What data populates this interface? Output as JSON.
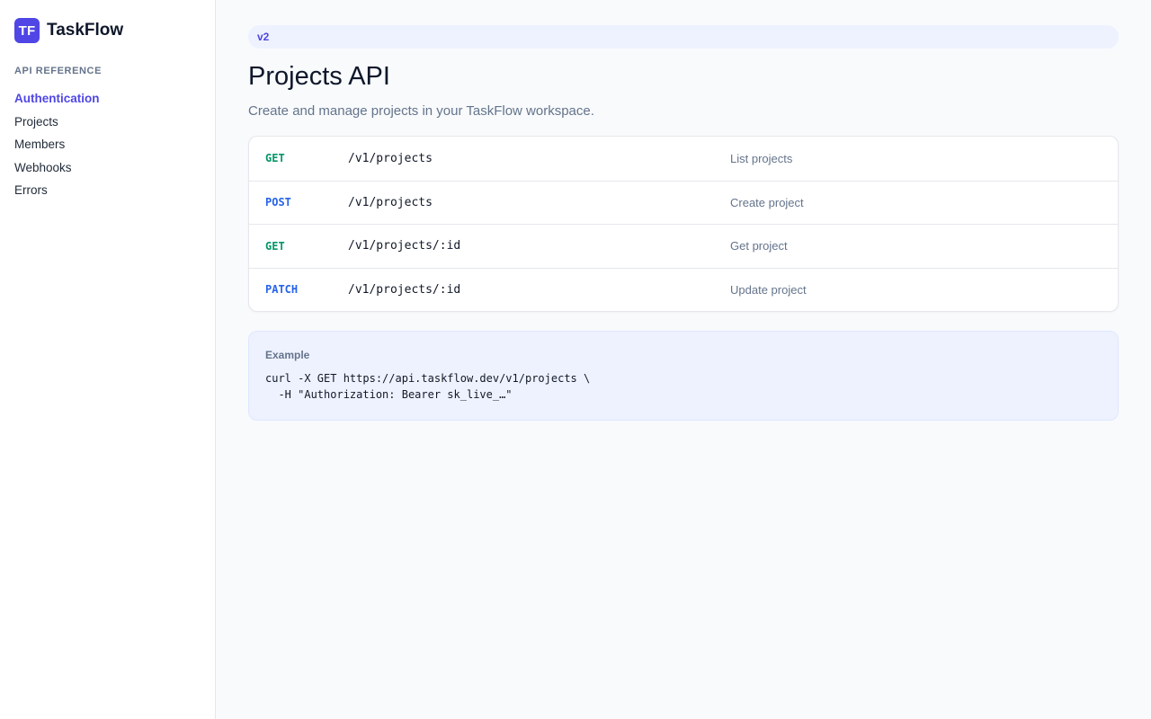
{
  "brand": {
    "logo_text": "TF",
    "name": "TaskFlow",
    "accent_color": "#4f46e5"
  },
  "sidebar": {
    "section_title": "API REFERENCE",
    "items": [
      {
        "label": "Authentication",
        "active": true
      },
      {
        "label": "Projects",
        "active": false
      },
      {
        "label": "Members",
        "active": false
      },
      {
        "label": "Webhooks",
        "active": false
      },
      {
        "label": "Errors",
        "active": false
      }
    ]
  },
  "main": {
    "version": "v2",
    "title": "Projects API",
    "subtitle": "Create and manage projects in your TaskFlow workspace.",
    "endpoints": [
      {
        "method": "GET",
        "method_color": "#059669",
        "path": "/v1/projects",
        "summary": "List projects"
      },
      {
        "method": "POST",
        "method_color": "#2563eb",
        "path": "/v1/projects",
        "summary": "Create project"
      },
      {
        "method": "GET",
        "method_color": "#059669",
        "path": "/v1/projects/:id",
        "summary": "Get project"
      },
      {
        "method": "PATCH",
        "method_color": "#2563eb",
        "path": "/v1/projects/:id",
        "summary": "Update project"
      }
    ],
    "example": {
      "label": "Example",
      "code_lines": [
        "curl -X GET https://api.taskflow.dev/v1/projects \\",
        "  -H \"Authorization: Bearer sk_live_…\""
      ]
    }
  }
}
